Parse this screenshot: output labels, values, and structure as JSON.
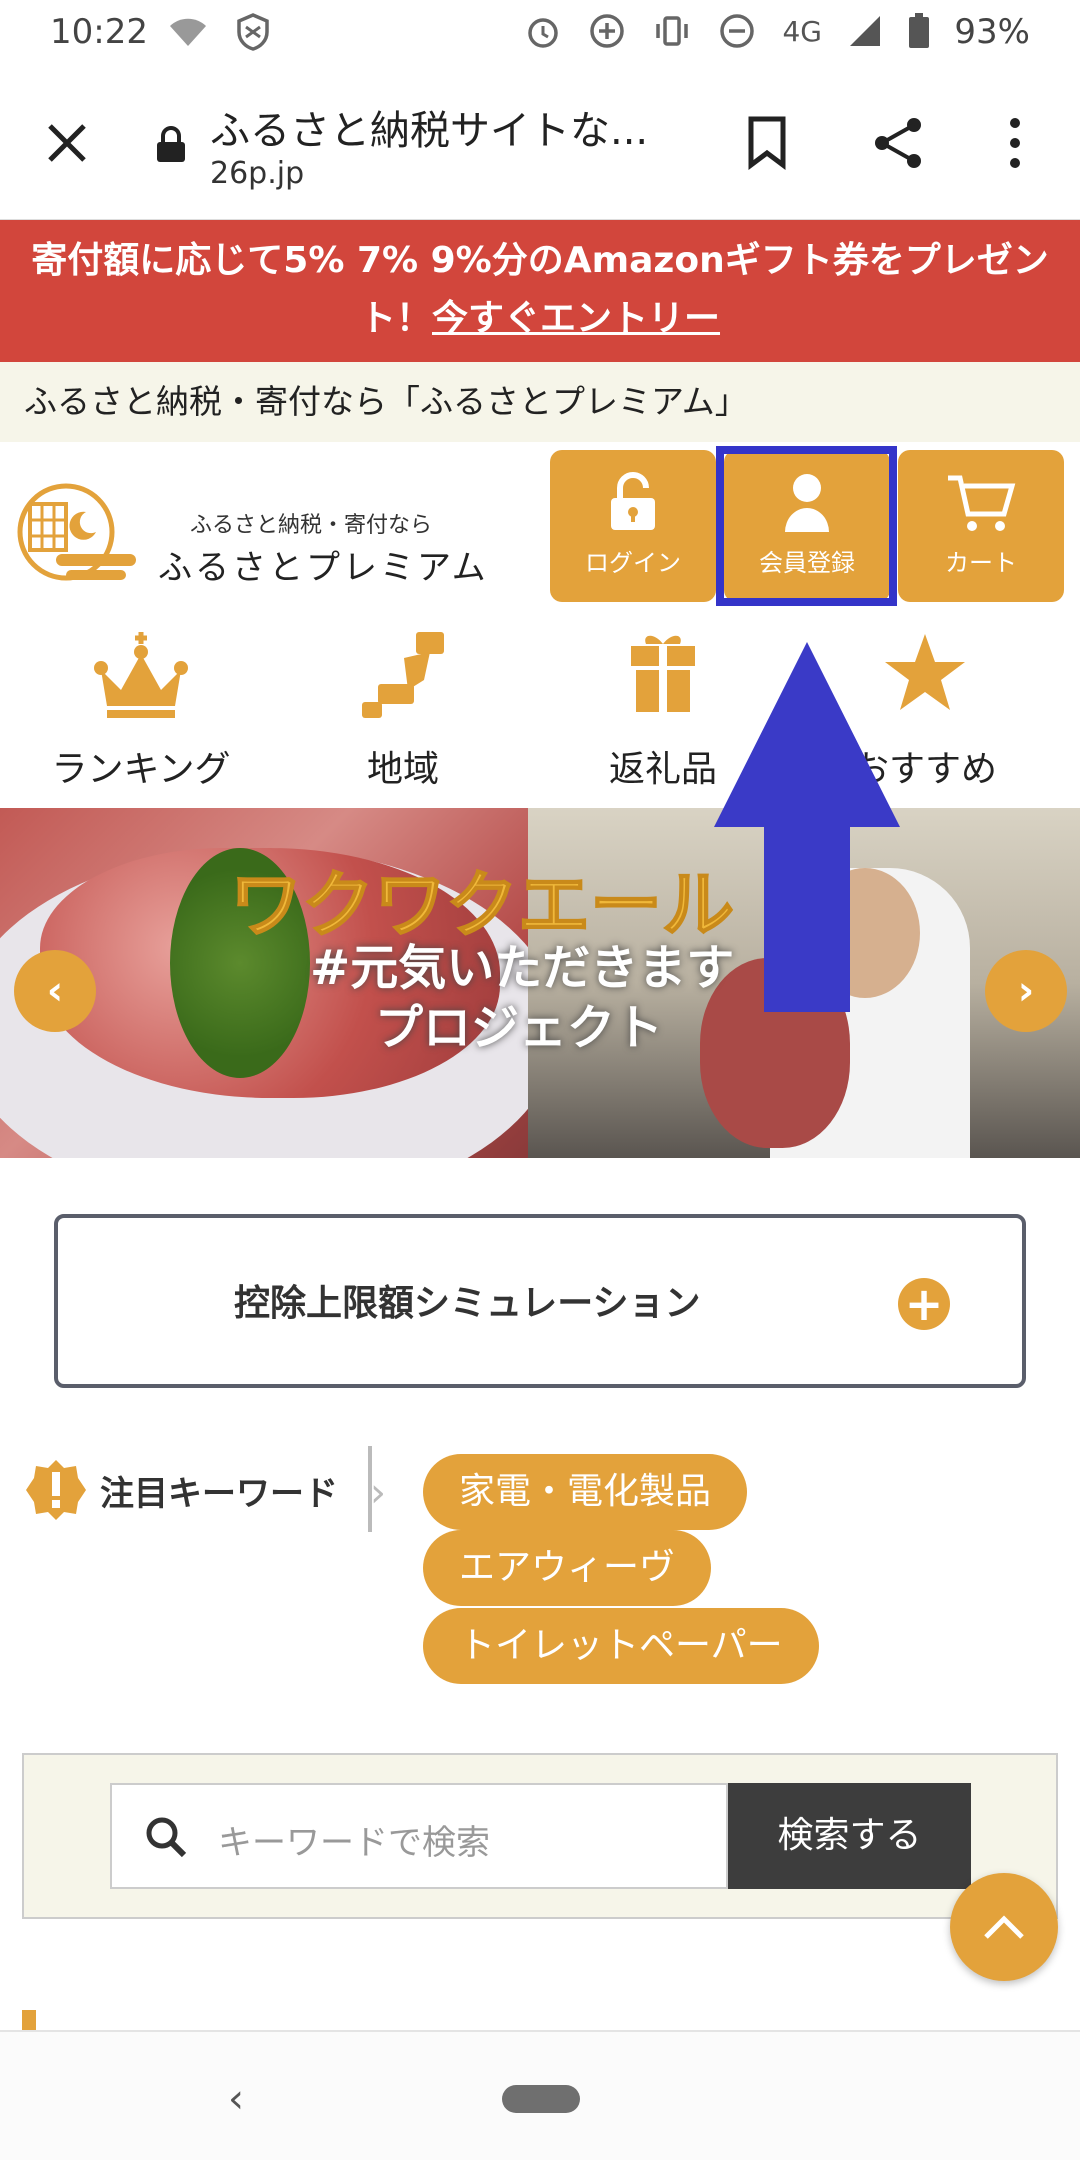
{
  "status": {
    "time": "10:22",
    "network": "4G",
    "battery": "93%"
  },
  "browser": {
    "title": "ふるさと納税サイトな...",
    "url": "26p.jp"
  },
  "banner": {
    "text": "寄付額に応じて5% 7% 9%分のAmazonギフト券をプレゼント！",
    "link": "今すぐエントリー"
  },
  "subhead": "ふるさと納税・寄付なら「ふるさとプレミアム」",
  "logo": {
    "small": "ふるさと納税・寄付なら",
    "big": "ふるさとプレミアム"
  },
  "header_buttons": {
    "login": "ログイン",
    "register": "会員登録",
    "cart": "カート"
  },
  "nav": [
    {
      "label": "ランキング",
      "icon": "crown-icon"
    },
    {
      "label": "地域",
      "icon": "japan-map-icon"
    },
    {
      "label": "返礼品",
      "icon": "gift-icon"
    },
    {
      "label": "おすすめ",
      "icon": "star-icon"
    }
  ],
  "hero": {
    "line1": "ワクワクエール",
    "line2": "#元気いただきます",
    "line3": "プロジェクト"
  },
  "simulation": {
    "label": "控除上限額シミュレーション"
  },
  "keywords": {
    "title": "注目キーワード",
    "tags": [
      "家電・電化製品",
      "エアウィーヴ",
      "トイレットペーパー"
    ]
  },
  "search": {
    "placeholder": "キーワードで検索",
    "button": "検索する"
  },
  "colors": {
    "accent": "#e3a23b",
    "banner": "#d2463c",
    "highlight": "#3434c9"
  }
}
